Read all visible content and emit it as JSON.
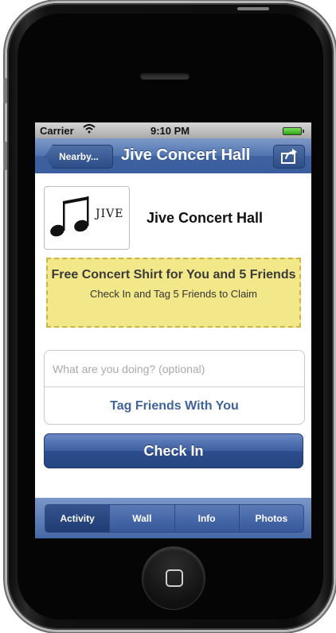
{
  "status_bar": {
    "carrier": "Carrier",
    "time": "9:10 PM"
  },
  "nav": {
    "back_label": "Nearby...",
    "title": "Jive Concert Hall",
    "share_icon": "share-icon"
  },
  "venue": {
    "name": "Jive Concert Hall",
    "logo_text": "JIVE"
  },
  "promo": {
    "title": "Free Concert Shirt for You and 5 Friends",
    "subtitle": "Check In and Tag 5 Friends to Claim"
  },
  "status_input": {
    "placeholder": "What are you doing? (optional)",
    "value": ""
  },
  "tag_friends_label": "Tag Friends With You",
  "checkin_label": "Check In",
  "tabs": [
    {
      "label": "Activity",
      "selected": true
    },
    {
      "label": "Wall",
      "selected": false
    },
    {
      "label": "Info",
      "selected": false
    },
    {
      "label": "Photos",
      "selected": false
    }
  ],
  "colors": {
    "nav_blue": "#3f62a1",
    "promo_yellow": "#f3e889",
    "link_blue": "#41639c"
  }
}
